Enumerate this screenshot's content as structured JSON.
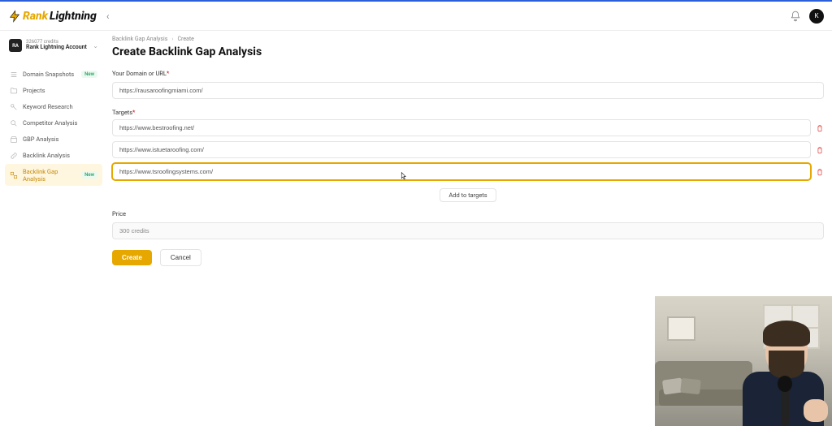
{
  "brand": {
    "rank": "Rank",
    "lightning": "Lightning"
  },
  "header": {
    "avatar_initial": "K"
  },
  "account": {
    "badge": "RA",
    "credits": "326077 credits",
    "name": "Rank Lightning Account"
  },
  "sidebar": {
    "items": [
      {
        "label": "Domain Snapshots",
        "badge": "New"
      },
      {
        "label": "Projects"
      },
      {
        "label": "Keyword Research"
      },
      {
        "label": "Competitor Analysis"
      },
      {
        "label": "GBP Analysis"
      },
      {
        "label": "Backlink Analysis"
      },
      {
        "label": "Backlink Gap Analysis",
        "badge": "New",
        "active": true
      }
    ]
  },
  "breadcrumb": {
    "parent": "Backlink Gap Analysis",
    "current": "Create"
  },
  "page": {
    "title": "Create Backlink Gap Analysis"
  },
  "form": {
    "domain_label": "Your Domain or URL",
    "domain_value": "https://rausaroofingmiami.com/",
    "targets_label": "Targets",
    "targets": [
      "https://www.bestroofing.net/",
      "https://www.istuetaroofing.com/",
      "https://www.tsroofingsystems.com/"
    ],
    "add_targets": "Add to targets",
    "price_label": "Price",
    "price_value": "300 credits",
    "create": "Create",
    "cancel": "Cancel"
  }
}
